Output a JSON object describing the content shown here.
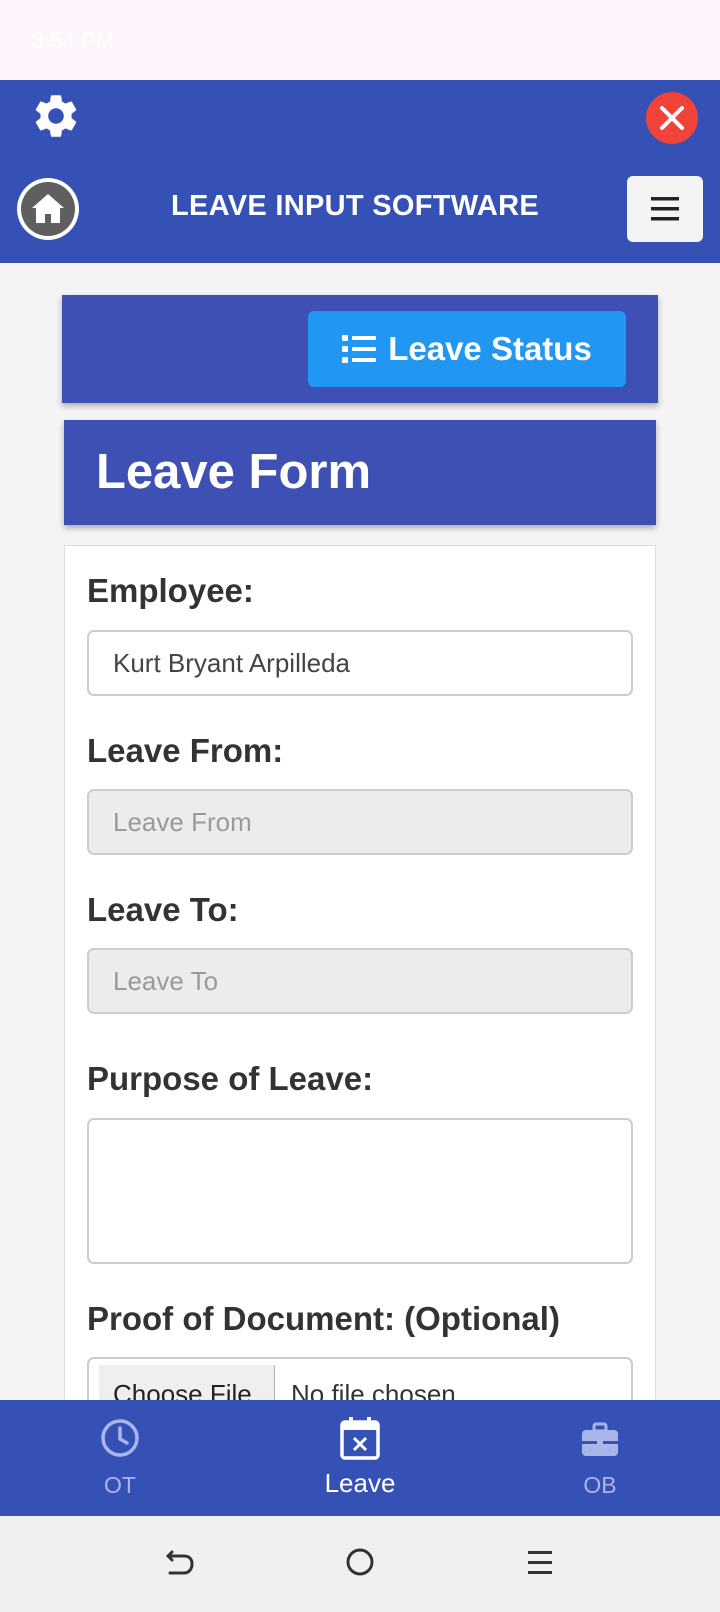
{
  "status_bar": {
    "time": "3:54 PM"
  },
  "header": {
    "title": "LEAVE INPUT SOFTWARE",
    "settings_icon": "gear-icon",
    "close_icon": "close-icon",
    "home_icon": "home-icon",
    "menu_icon": "hamburger-menu-icon"
  },
  "toolbar": {
    "leave_status_label": "Leave Status"
  },
  "form": {
    "title": "Leave Form",
    "employee": {
      "label": "Employee:",
      "value": "Kurt Bryant Arpilleda"
    },
    "leave_from": {
      "label": "Leave From:",
      "placeholder": "Leave From"
    },
    "leave_to": {
      "label": "Leave To:",
      "placeholder": "Leave To"
    },
    "purpose": {
      "label": "Purpose of Leave:",
      "value": ""
    },
    "proof": {
      "label": "Proof of Document: (Optional)",
      "button": "Choose File",
      "status": "No file chosen"
    }
  },
  "bottom_nav": {
    "items": [
      {
        "label": "OT",
        "icon": "clock-icon",
        "active": false
      },
      {
        "label": "Leave",
        "icon": "calendar-x-icon",
        "active": true
      },
      {
        "label": "OB",
        "icon": "briefcase-icon",
        "active": false
      }
    ]
  },
  "colors": {
    "primary": "#3651b5",
    "card_header": "#3e50b4",
    "accent_button": "#2196f3",
    "close": "#f0433a"
  }
}
